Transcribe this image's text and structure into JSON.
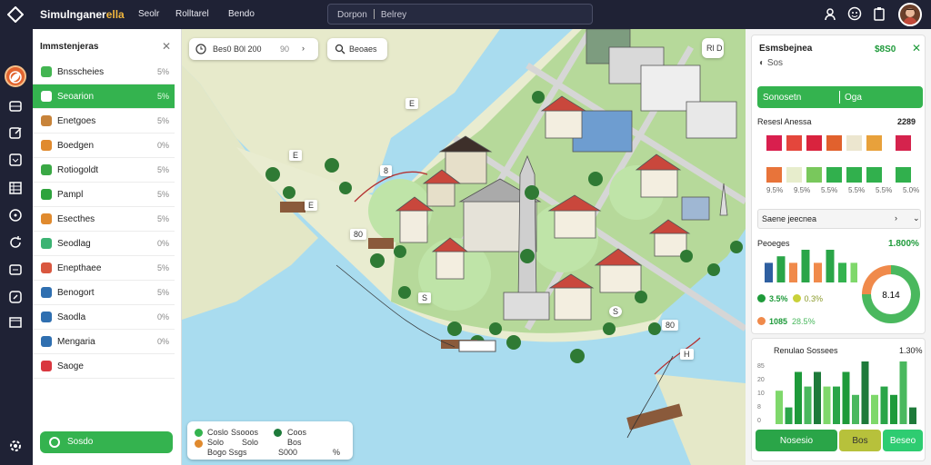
{
  "app": {
    "title_main": "Simulnganer",
    "title_accent": "ella"
  },
  "nav": [
    "Seolr",
    "Rolltarel",
    "Bendo"
  ],
  "search": {
    "left": "Dorpon",
    "right": "Belrey"
  },
  "sidebar": {
    "title": "Immstenjeras",
    "items": [
      {
        "label": "Bnsscheies",
        "pct": "5%",
        "color": "#43b552"
      },
      {
        "label": "Seoarion",
        "pct": "5%",
        "color": "#34b34f"
      },
      {
        "label": "Enetgoes",
        "pct": "5%",
        "color": "#c7833a"
      },
      {
        "label": "Boedgen",
        "pct": "0%",
        "color": "#e08a2e"
      },
      {
        "label": "Rotiogoldt",
        "pct": "5%",
        "color": "#3aa845"
      },
      {
        "label": "Pampl",
        "pct": "5%",
        "color": "#2ea33d"
      },
      {
        "label": "Esecthes",
        "pct": "5%",
        "color": "#e08a2e"
      },
      {
        "label": "Seodlag",
        "pct": "0%",
        "color": "#3cb373"
      },
      {
        "label": "Enepthaee",
        "pct": "5%",
        "color": "#d9573f"
      },
      {
        "label": "Benogort",
        "pct": "5%",
        "color": "#2f6fb0"
      },
      {
        "label": "Saodla",
        "pct": "0%",
        "color": "#2f6fb0"
      },
      {
        "label": "Mengaria",
        "pct": "0%",
        "color": "#2f6fb0"
      },
      {
        "label": "Saoge",
        "pct": "",
        "color": "#d9373f"
      }
    ],
    "button": "Sosdo"
  },
  "map": {
    "coord_pill": "Bes0 B0l 200",
    "coord_pill2": "90",
    "search_pill": "Beoaes",
    "tools": "Rl D",
    "labels": [
      "E",
      "E",
      "8",
      "E",
      "80",
      "S",
      "S",
      "80",
      "H"
    ],
    "legend": {
      "row1a": "Coslo",
      "row1b": "Ssooos",
      "row1c": "Coos",
      "row2a": "Solo",
      "row2b": "Solo",
      "row2c": "Bos",
      "row3a": "Bogo Ssgs",
      "row3b": "S000",
      "row3c": "%"
    }
  },
  "panel": {
    "title": "Esmsbejnea",
    "value": "$8S0",
    "sub": "Sos",
    "btn_left": "Sonosetn",
    "btn_right": "Oga",
    "grid_title": "Resesl Anessa",
    "grid_value": "2289",
    "grid_colors": [
      [
        "#d91f4e",
        "#e4463c",
        "#d9233e",
        "#e1612d",
        "#ece6cf",
        "#e8a13b",
        "#d5234d"
      ],
      [
        "#e8743a",
        "#e7edcc",
        "#79c85c",
        "#31b04d",
        "#31b04d",
        "#31b04d",
        "#31b04d"
      ]
    ],
    "grid_cap": [
      "9.5%",
      "9.5%",
      "5.5%",
      "5.5%",
      "5.5%",
      "5.0%"
    ],
    "select": "Saene jeecnea",
    "donut_title": "Peoeges",
    "donut_value": "1.800%",
    "donut_center": "8.14",
    "legend": [
      {
        "a": "3.5%",
        "b": "0.3%"
      },
      {
        "a": "1085",
        "b": "28.5%"
      }
    ],
    "bars_title": "Renulao Sossees",
    "bars_value": "1.30%",
    "axis": [
      "85",
      "20",
      "10",
      "8",
      "0"
    ],
    "footer_a": "Nosesio",
    "footer_b": "Bos",
    "footer_c": "Beseo"
  },
  "chart_data": [
    {
      "type": "bar",
      "title": "Peoeges",
      "values": [
        12,
        16,
        12,
        20,
        12,
        20,
        12,
        12
      ]
    },
    {
      "type": "pie",
      "values": [
        75,
        25
      ],
      "colors": [
        "#4ab85e",
        "#f08a4b"
      ],
      "center_label": "8.14"
    },
    {
      "type": "bar",
      "title": "Renulao Sossees",
      "series": [
        {
          "values": [
            16,
            8,
            25,
            18,
            25,
            18,
            18,
            25,
            14,
            30,
            14,
            18,
            14,
            30,
            8
          ]
        }
      ]
    }
  ]
}
